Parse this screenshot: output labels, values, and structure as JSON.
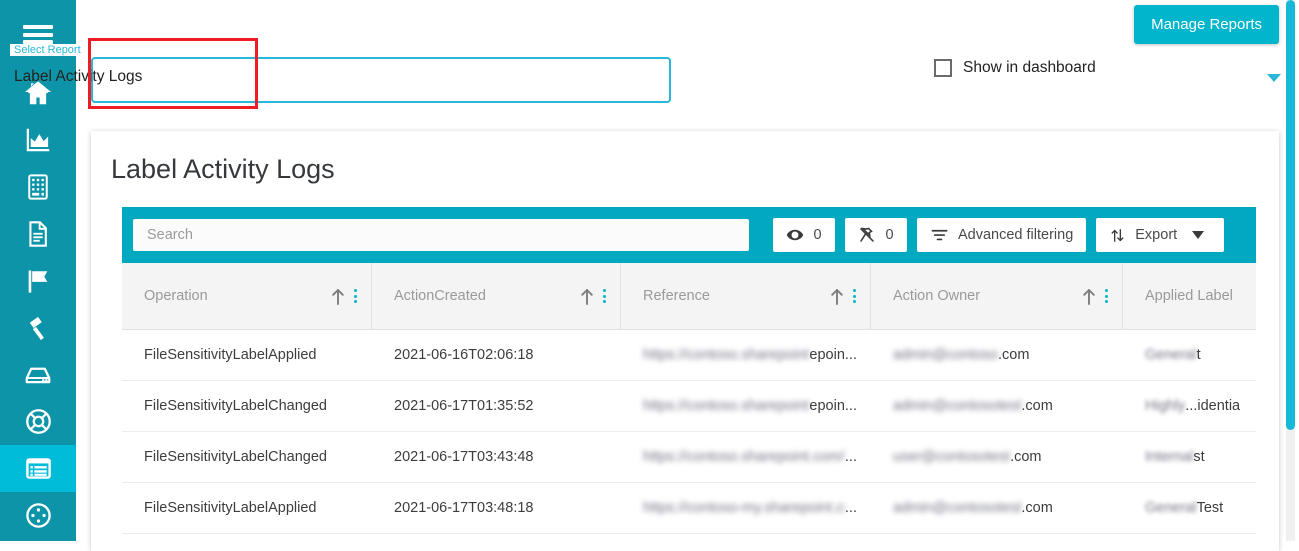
{
  "sidebar": {
    "items": [
      {
        "name": "hamburger-menu",
        "icon": "hamburger-icon",
        "active": false
      },
      {
        "name": "home",
        "icon": "home-icon",
        "active": false
      },
      {
        "name": "analytics",
        "icon": "area-chart-icon",
        "active": false
      },
      {
        "name": "calculator",
        "icon": "calculator-icon",
        "active": false
      },
      {
        "name": "documents",
        "icon": "document-icon",
        "active": false
      },
      {
        "name": "flags",
        "icon": "flag-icon",
        "active": false
      },
      {
        "name": "remediation",
        "icon": "gavel-icon",
        "active": false
      },
      {
        "name": "storage",
        "icon": "hard-drive-icon",
        "active": false
      },
      {
        "name": "support",
        "icon": "life-ring-icon",
        "active": false
      },
      {
        "name": "reports",
        "icon": "report-list-icon",
        "active": true
      },
      {
        "name": "settings",
        "icon": "settings-circle-icon",
        "active": false
      }
    ]
  },
  "header": {
    "manage_reports_label": "Manage Reports",
    "select_report_legend": "Select Report",
    "select_report_value": "Label Activity Logs",
    "select_caret_icon": "chevron-down-icon",
    "show_in_dashboard_label": "Show in dashboard",
    "show_in_dashboard_checked": false
  },
  "card": {
    "title": "Label Activity Logs"
  },
  "toolbar": {
    "search_placeholder": "Search",
    "search_value": "",
    "visible_icon": "eye-icon",
    "visible_count": "0",
    "pinned_icon": "unpin-icon",
    "pinned_count": "0",
    "filter_icon": "filter-icon",
    "filter_label": "Advanced filtering",
    "export_icon": "sort-arrows-icon",
    "export_label": "Export",
    "export_caret_icon": "caret-down-icon"
  },
  "table": {
    "columns": [
      {
        "label": "Operation",
        "sort_icon": "arrow-up-icon",
        "menu_icon": "kebab-menu-icon",
        "sortable": true
      },
      {
        "label": "ActionCreated",
        "sort_icon": "arrow-up-icon",
        "menu_icon": "kebab-menu-icon",
        "sortable": true
      },
      {
        "label": "Reference",
        "sort_icon": "arrow-up-icon",
        "menu_icon": "kebab-menu-icon",
        "sortable": true
      },
      {
        "label": "Action Owner",
        "sort_icon": "arrow-up-icon",
        "menu_icon": "kebab-menu-icon",
        "sortable": true
      },
      {
        "label": "Applied Label",
        "sort_icon": "",
        "menu_icon": "",
        "sortable": false
      }
    ],
    "rows": [
      {
        "operation": "FileSensitivityLabelApplied",
        "action_created": "2021-06-16T02:06:18",
        "reference_redacted": "https://contoso.sharepoint.com/sites/site",
        "reference_tail": "epoin...",
        "action_owner_redacted": "admin@contoso",
        "action_owner_tail": ".com",
        "applied_label_redacted": "General",
        "applied_label_tail": "t"
      },
      {
        "operation": "FileSensitivityLabelChanged",
        "action_created": "2021-06-17T01:35:52",
        "reference_redacted": "https://contoso.sharepoint.com/sites",
        "reference_tail": "epoin...",
        "action_owner_redacted": "admin@contosotest",
        "action_owner_tail": ".com",
        "applied_label_redacted": "Highly",
        "applied_label_tail": "...identia"
      },
      {
        "operation": "FileSensitivityLabelChanged",
        "action_created": "2021-06-17T03:43:48",
        "reference_redacted": "https://contoso.sharepoint.com/personal",
        "reference_tail": "...",
        "action_owner_redacted": "user@contosotest",
        "action_owner_tail": ".com",
        "applied_label_redacted": "Internal",
        "applied_label_tail": "st"
      },
      {
        "operation": "FileSensitivityLabelApplied",
        "action_created": "2021-06-17T03:48:18",
        "reference_redacted": "https://contoso-my.sharepoint.com/test.xlsx",
        "reference_tail": "...",
        "action_owner_redacted": "admin@contosotest",
        "action_owner_tail": ".com",
        "applied_label_redacted": "General",
        "applied_label_tail": "Test"
      }
    ]
  },
  "colors": {
    "sidebar": "#0d94a8",
    "sidebar_active": "#00bcd9",
    "accent": "#00b5cc",
    "toolbar": "#00a9c0",
    "annotation": "#ee1c25",
    "scrollbar": "#18b9d8"
  }
}
